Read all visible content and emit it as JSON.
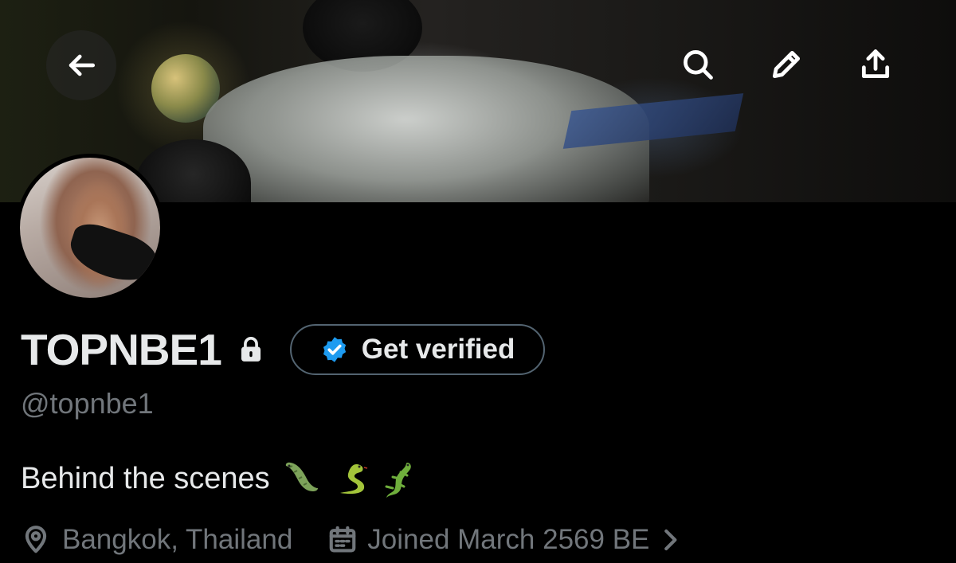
{
  "header": {
    "back_icon": "arrow-left-icon",
    "actions": [
      {
        "name": "search",
        "icon": "search-icon"
      },
      {
        "name": "edit",
        "icon": "pencil-icon"
      },
      {
        "name": "share",
        "icon": "share-upload-icon"
      }
    ]
  },
  "profile": {
    "display_name": "TOPNBE1",
    "protected_icon": "lock-icon",
    "verify_button_label": "Get verified",
    "verify_badge_color": "#1d9bf0",
    "handle": "@topnbe1",
    "bio_text": "Behind the scenes",
    "bio_emojis": [
      "crocodile-emoji",
      "snake-emoji",
      "lizard-emoji"
    ],
    "location": "Bangkok, Thailand",
    "joined": "Joined March 2569 BE"
  },
  "colors": {
    "background": "#000000",
    "primary_text": "#e7e9ea",
    "secondary_text": "#71767b",
    "border": "#536471"
  }
}
